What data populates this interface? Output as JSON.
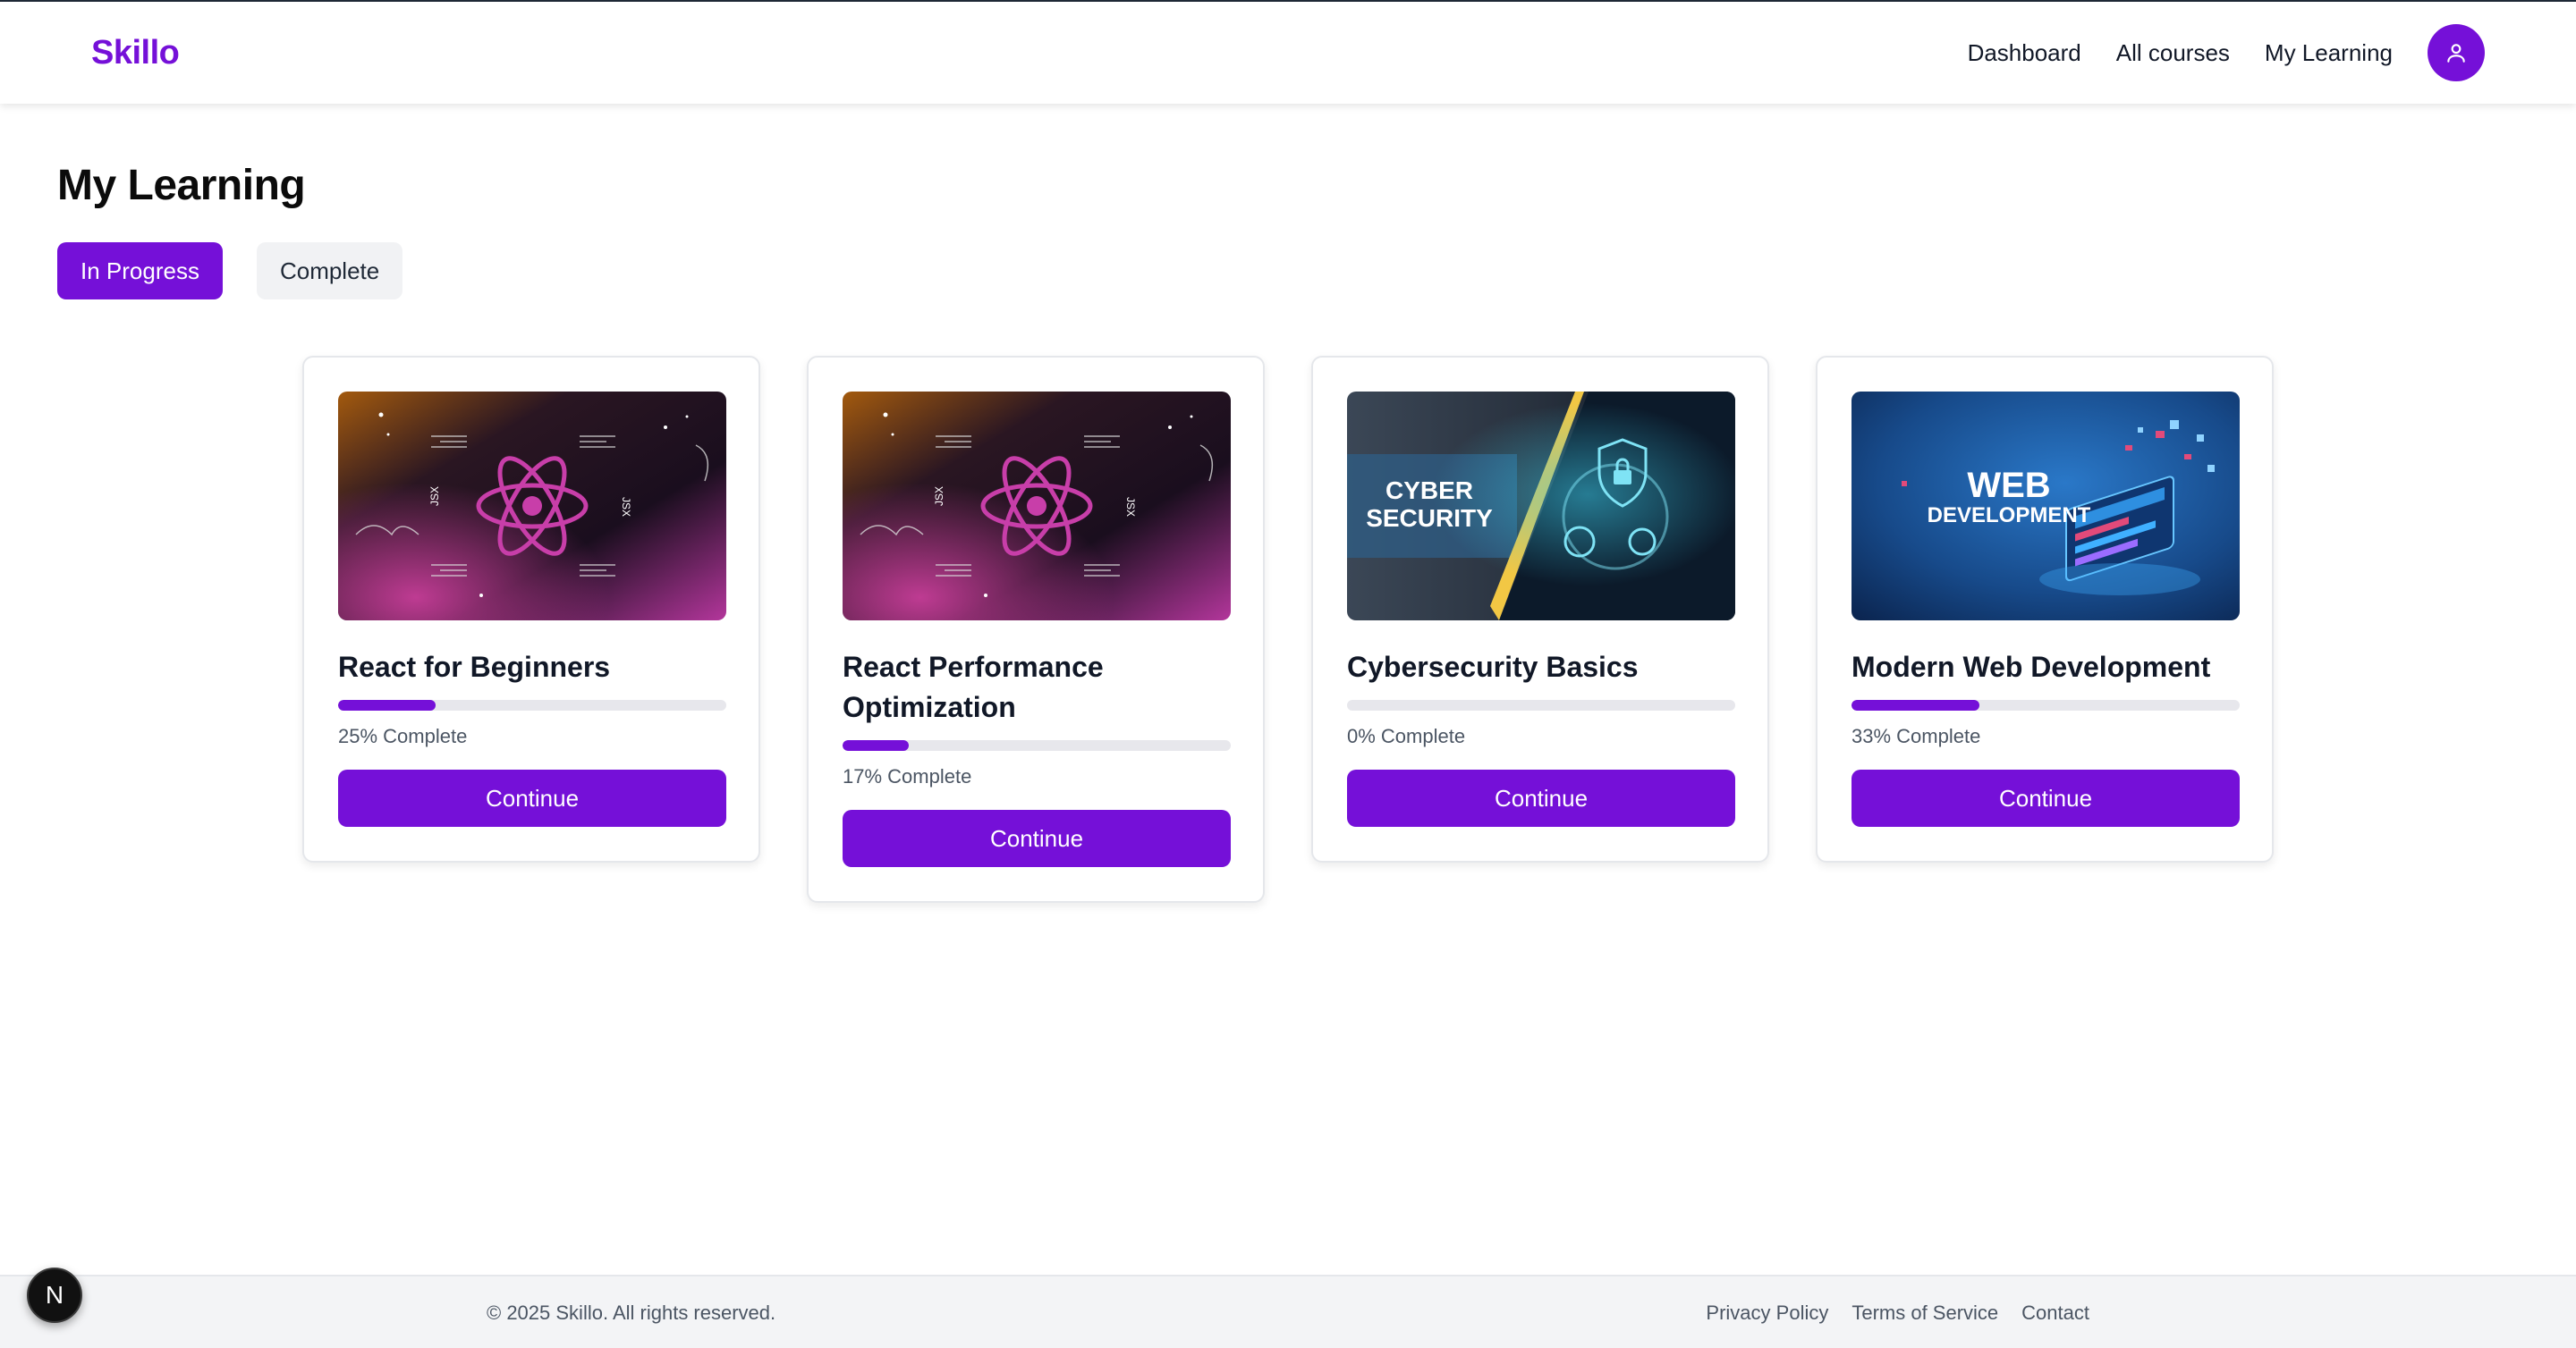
{
  "brand": {
    "name": "Skillo",
    "color": "#7510d8"
  },
  "nav": {
    "links": [
      "Dashboard",
      "All courses",
      "My Learning"
    ],
    "avatar_icon": "user-icon"
  },
  "page": {
    "title": "My Learning",
    "tabs": [
      {
        "label": "In Progress",
        "active": true
      },
      {
        "label": "Complete",
        "active": false
      }
    ]
  },
  "courses": [
    {
      "title": "React for Beginners",
      "progress": 25,
      "progress_label": "25% Complete",
      "button": "Continue",
      "thumbnail": "react-logo-image"
    },
    {
      "title": "React Performance Optimization",
      "progress": 17,
      "progress_label": "17% Complete",
      "button": "Continue",
      "thumbnail": "react-logo-image"
    },
    {
      "title": "Cybersecurity Basics",
      "progress": 0,
      "progress_label": "0% Complete",
      "button": "Continue",
      "thumbnail": "cyber-security-image",
      "thumb_text": [
        "CYBER",
        "SECURITY"
      ]
    },
    {
      "title": "Modern Web Development",
      "progress": 33,
      "progress_label": "33% Complete",
      "button": "Continue",
      "thumbnail": "web-development-image",
      "thumb_text": [
        "WEB",
        "DEVELOPMENT"
      ]
    }
  ],
  "thumb_labels": {
    "jsx": "JSX"
  },
  "footer": {
    "copyright": "© 2025 Skillo. All rights reserved.",
    "links": [
      "Privacy Policy",
      "Terms of Service",
      "Contact"
    ]
  },
  "dev_badge": {
    "letter": "N",
    "icon": "nextjs-icon"
  },
  "colors": {
    "accent": "#7510d8",
    "track": "#e7e7ec",
    "footer_bg": "#f3f4f6"
  }
}
